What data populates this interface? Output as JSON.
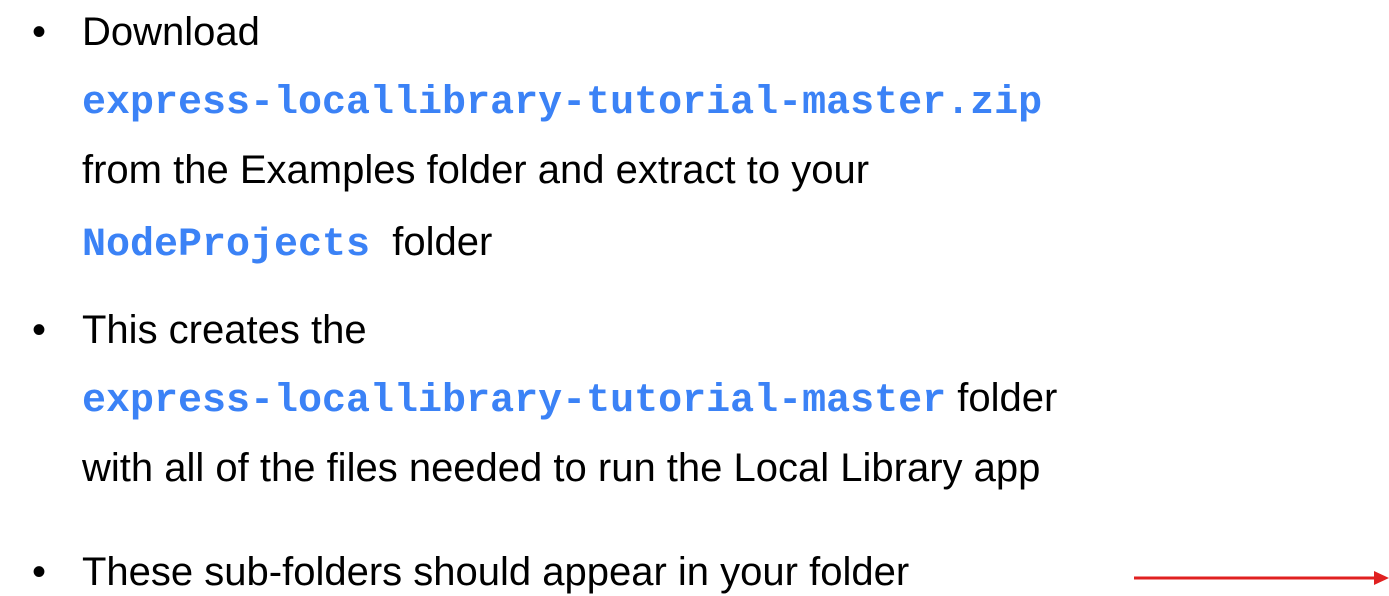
{
  "bullets": [
    {
      "lines": [
        [
          {
            "text": "Download",
            "code": false
          }
        ],
        [
          {
            "text": "express-locallibrary-tutorial-master.zip",
            "code": true
          }
        ],
        [
          {
            "text": "from the Examples folder and extract to your",
            "code": false
          }
        ],
        [
          {
            "text": "NodeProjects",
            "code": true
          },
          {
            "text": "  folder",
            "code": false
          }
        ]
      ]
    },
    {
      "lines": [
        [
          {
            "text": "This creates the",
            "code": false
          }
        ],
        [
          {
            "text": "express-locallibrary-tutorial-master",
            "code": true
          },
          {
            "text": " folder",
            "code": false
          }
        ],
        [
          {
            "text": "with all of the files needed to run the Local Library app",
            "code": false
          }
        ]
      ]
    },
    {
      "lines": [
        [
          {
            "text": "These sub-folders should appear in your folder",
            "code": false
          }
        ]
      ]
    }
  ],
  "bullet_glyph": "•",
  "colors": {
    "code": "#3b82f6",
    "text": "#000000",
    "arrow": "#e02020"
  }
}
